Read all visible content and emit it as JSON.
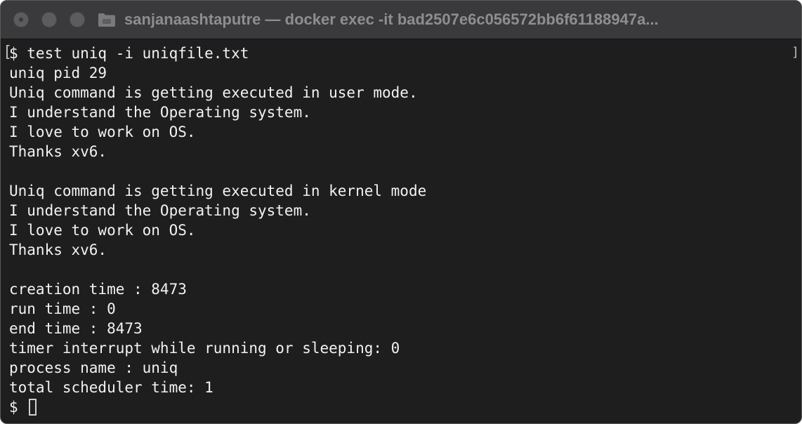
{
  "window": {
    "title": "sanjanaashtaputre — docker exec -it bad2507e6c056572bb6f61188947a..."
  },
  "terminal": {
    "lines": [
      "$ test uniq -i uniqfile.txt",
      "uniq pid 29",
      "Uniq command is getting executed in user mode.",
      "I understand the Operating system.",
      "I love to work on OS.",
      "Thanks xv6.",
      "",
      "Uniq command is getting executed in kernel mode",
      "I understand the Operating system.",
      "I love to work on OS.",
      "Thanks xv6.",
      "",
      "creation time : 8473",
      "run time : 0",
      "end time : 8473",
      "timer interrupt while running or sleeping: 0",
      "process name : uniq",
      "total scheduler time: 1"
    ],
    "prompt": "$ ",
    "left_bracket": "[",
    "right_bracket": "]"
  },
  "colors": {
    "background": "#1e1e1e",
    "titlebar": "#3a3a3c",
    "text": "#f2f2f2",
    "title_text": "#8e8e90"
  },
  "icons": {
    "close": "close-button-icon",
    "minimize": "minimize-button-icon",
    "zoom": "zoom-button-icon",
    "folder": "folder-icon"
  }
}
